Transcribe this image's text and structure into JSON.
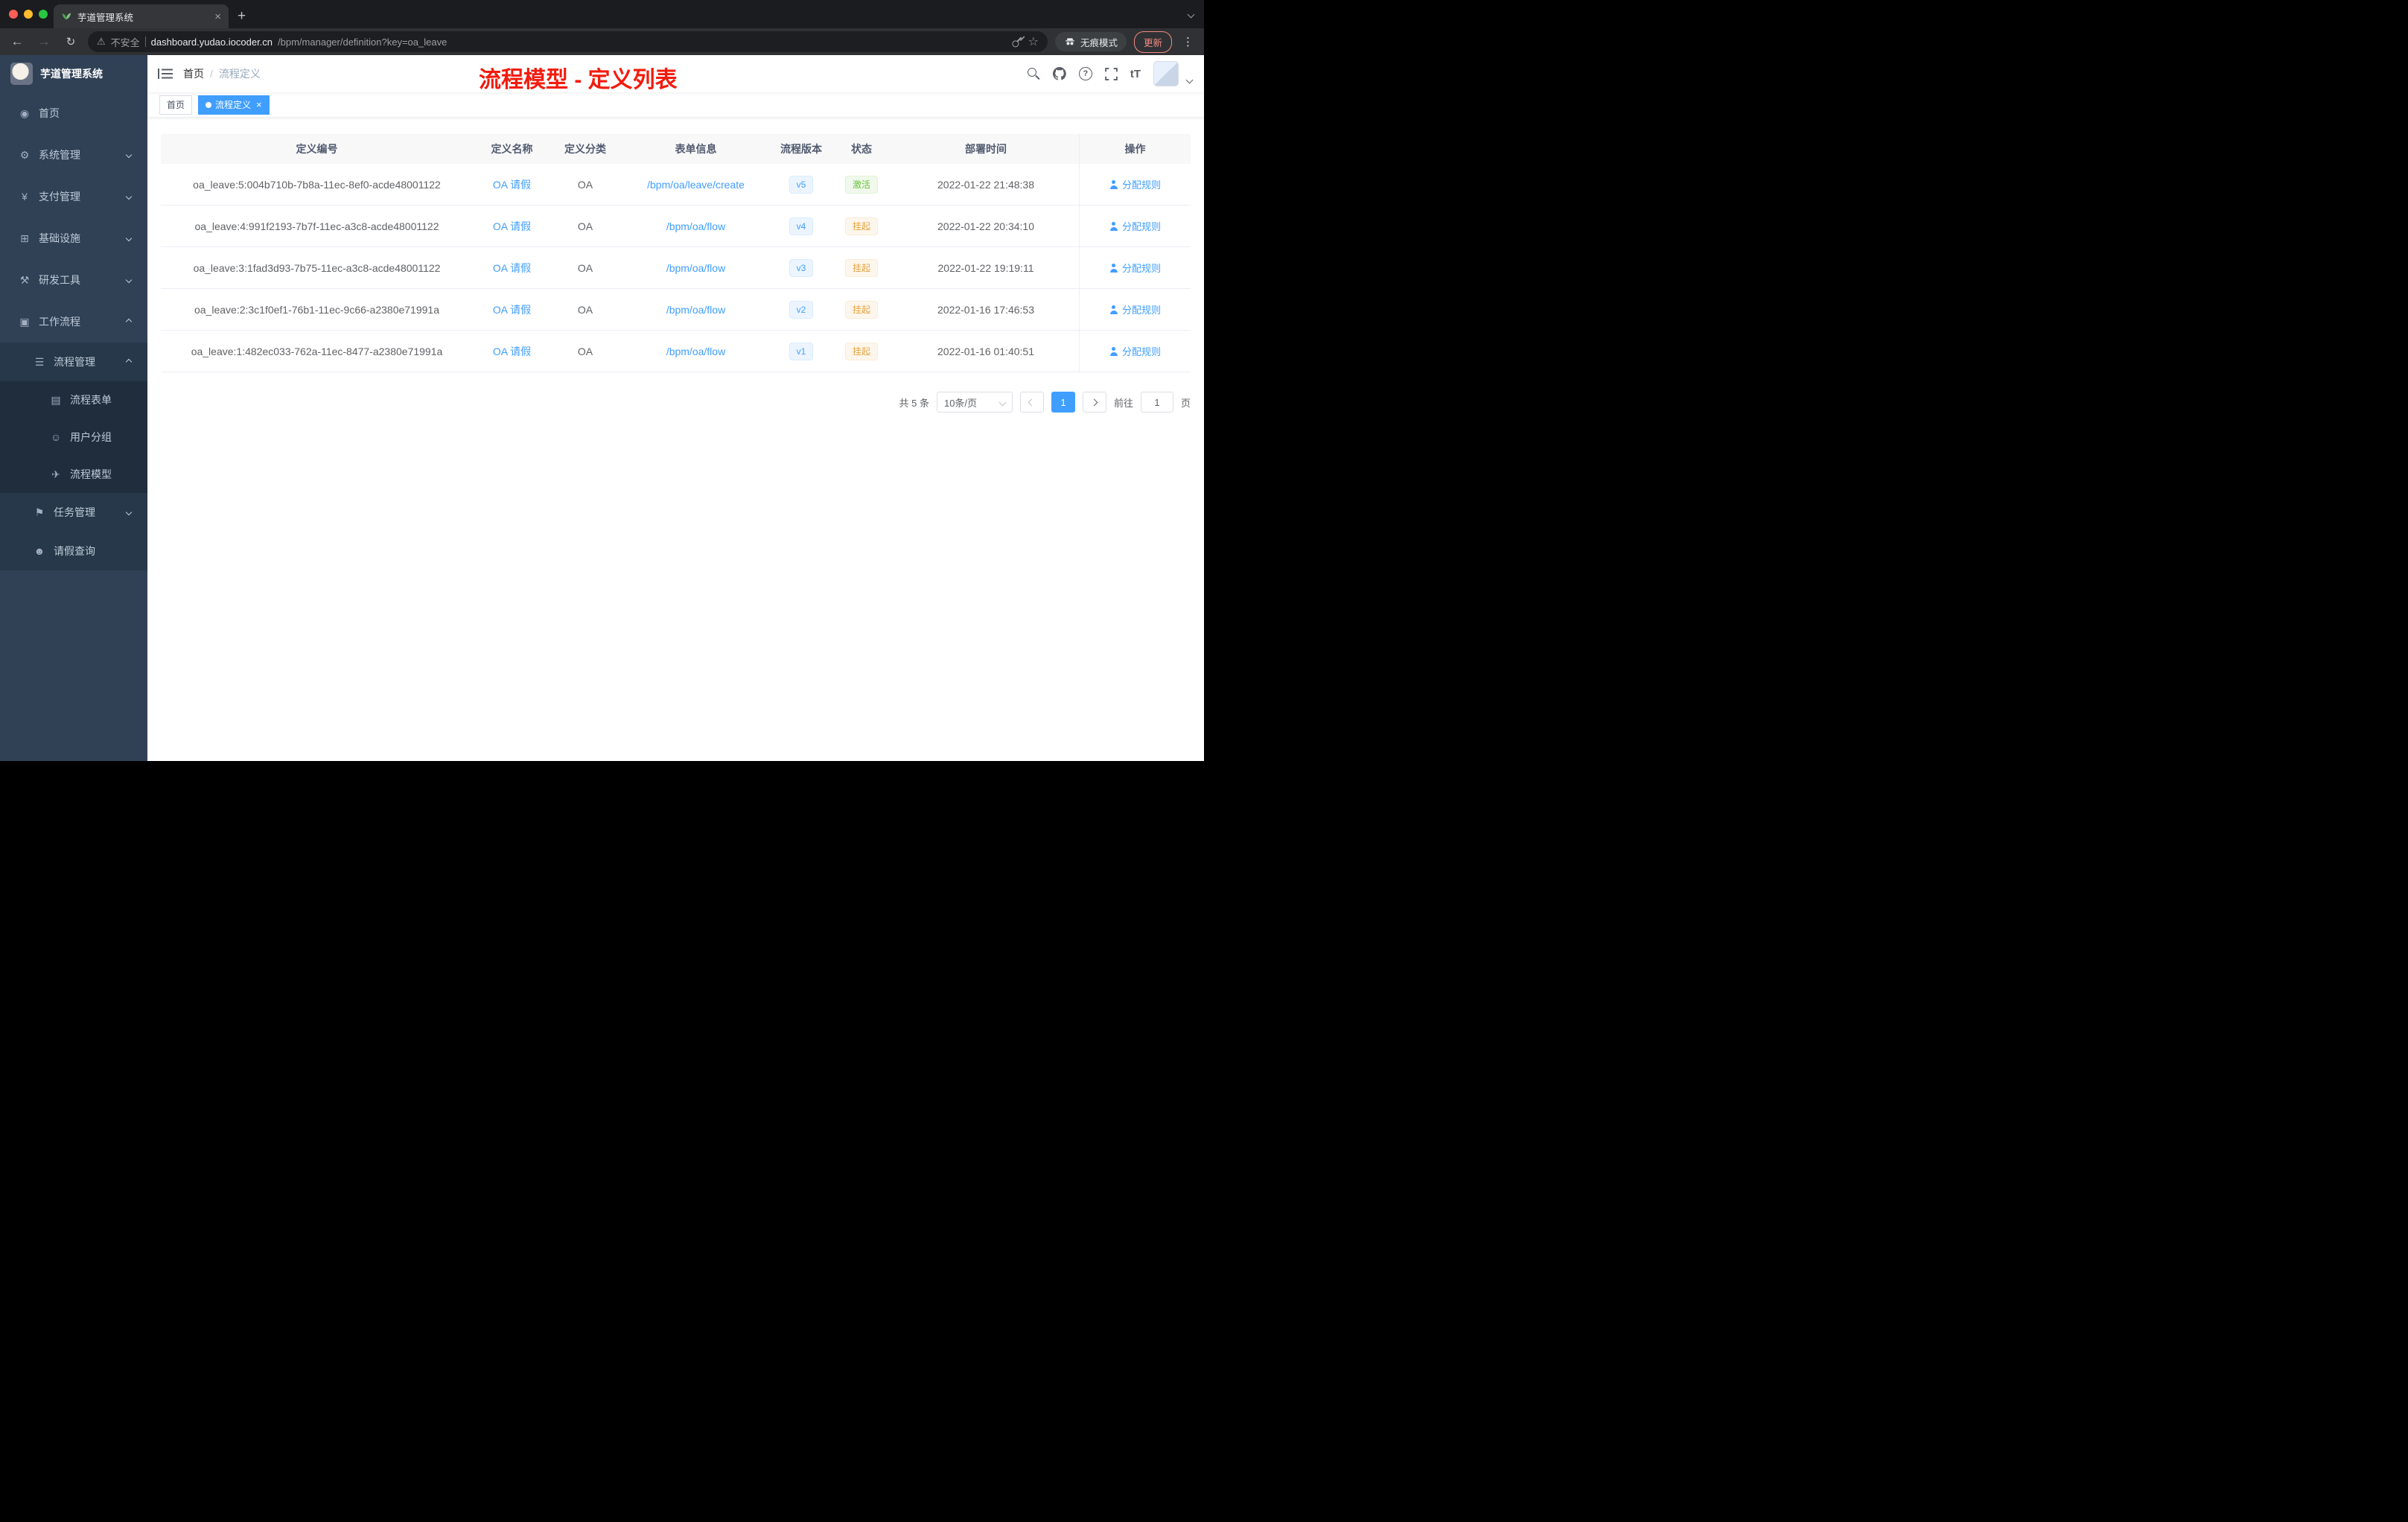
{
  "browser": {
    "tab": {
      "title": "芋道管理系统",
      "close_glyph": "×",
      "new_tab_glyph": "+"
    },
    "toolbar": {
      "security_label": "不安全",
      "url_host": "dashboard.yudao.iocoder.cn",
      "url_path": "/bpm/manager/definition?key=oa_leave",
      "incognito_label": "无痕模式",
      "update_label": "更新",
      "icons": {
        "back": "←",
        "forward": "→",
        "reload": "↻",
        "warning": "⚠",
        "star": "☆",
        "dots": "⋮"
      }
    }
  },
  "sidebar": {
    "logo_title": "芋道管理系统",
    "menu": [
      {
        "key": "home",
        "label": "首页",
        "icon": "dashboard-icon",
        "glyph": "◉",
        "level": 1,
        "expand": null
      },
      {
        "key": "system-management",
        "label": "系统管理",
        "icon": "gear-icon",
        "glyph": "⚙",
        "level": 1,
        "expand": "down"
      },
      {
        "key": "payment-management",
        "label": "支付管理",
        "icon": "yen-icon",
        "glyph": "¥",
        "level": 1,
        "expand": "down"
      },
      {
        "key": "infrastructure",
        "label": "基础设施",
        "icon": "infrastructure-icon",
        "glyph": "⊞",
        "level": 1,
        "expand": "down"
      },
      {
        "key": "dev-tools",
        "label": "研发工具",
        "icon": "tools-icon",
        "glyph": "⚒",
        "level": 1,
        "expand": "down"
      },
      {
        "key": "workflow",
        "label": "工作流程",
        "icon": "workflow-icon",
        "glyph": "▣",
        "level": 1,
        "expand": "up"
      },
      {
        "key": "process-management",
        "label": "流程管理",
        "icon": "process-list-icon",
        "glyph": "☰",
        "level": 2,
        "expand": "up"
      },
      {
        "key": "process-form",
        "label": "流程表单",
        "icon": "form-icon",
        "glyph": "▤",
        "level": 3,
        "expand": null
      },
      {
        "key": "user-group",
        "label": "用户分组",
        "icon": "user-group-icon",
        "glyph": "☺",
        "level": 3,
        "expand": null
      },
      {
        "key": "process-model",
        "label": "流程模型",
        "icon": "paper-plane-icon",
        "glyph": "✈",
        "level": 3,
        "expand": null
      },
      {
        "key": "task-management",
        "label": "任务管理",
        "icon": "flag-icon",
        "glyph": "⚑",
        "level": 2,
        "expand": "down"
      },
      {
        "key": "leave-query",
        "label": "请假查询",
        "icon": "person-icon",
        "glyph": "☻",
        "level": 2,
        "expand": null
      }
    ]
  },
  "header": {
    "breadcrumb": {
      "home": "首页",
      "separator": "/",
      "current": "流程定义"
    },
    "annotation": "流程模型 - 定义列表",
    "icons": {
      "question": "?",
      "font_size": "tT"
    }
  },
  "tags": [
    {
      "label": "首页",
      "active": false,
      "closable": false
    },
    {
      "label": "流程定义",
      "active": true,
      "closable": true
    }
  ],
  "table": {
    "columns": [
      "定义编号",
      "定义名称",
      "定义分类",
      "表单信息",
      "流程版本",
      "状态",
      "部署时间",
      "操作"
    ],
    "rows": [
      {
        "id": "oa_leave:5:004b710b-7b8a-11ec-8ef0-acde48001122",
        "name": "OA 请假",
        "category": "OA",
        "form": "/bpm/oa/leave/create",
        "version": "v5",
        "status": "激活",
        "status_type": "success",
        "deploy_time": "2022-01-22 21:48:38",
        "action": "分配规则"
      },
      {
        "id": "oa_leave:4:991f2193-7b7f-11ec-a3c8-acde48001122",
        "name": "OA 请假",
        "category": "OA",
        "form": "/bpm/oa/flow",
        "version": "v4",
        "status": "挂起",
        "status_type": "warning",
        "deploy_time": "2022-01-22 20:34:10",
        "action": "分配规则"
      },
      {
        "id": "oa_leave:3:1fad3d93-7b75-11ec-a3c8-acde48001122",
        "name": "OA 请假",
        "category": "OA",
        "form": "/bpm/oa/flow",
        "version": "v3",
        "status": "挂起",
        "status_type": "warning",
        "deploy_time": "2022-01-22 19:19:11",
        "action": "分配规则"
      },
      {
        "id": "oa_leave:2:3c1f0ef1-76b1-11ec-9c66-a2380e71991a",
        "name": "OA 请假",
        "category": "OA",
        "form": "/bpm/oa/flow",
        "version": "v2",
        "status": "挂起",
        "status_type": "warning",
        "deploy_time": "2022-01-16 17:46:53",
        "action": "分配规则"
      },
      {
        "id": "oa_leave:1:482ec033-762a-11ec-8477-a2380e71991a",
        "name": "OA 请假",
        "category": "OA",
        "form": "/bpm/oa/flow",
        "version": "v1",
        "status": "挂起",
        "status_type": "warning",
        "deploy_time": "2022-01-16 01:40:51",
        "action": "分配规则"
      }
    ]
  },
  "pagination": {
    "total": "共 5 条",
    "page_size": "10条/页",
    "current_page": "1",
    "goto_label": "前往",
    "goto_value": "1",
    "unit_label": "页"
  },
  "colors": {
    "accent_blue": "#409eff",
    "success_green": "#67c23a",
    "warning_orange": "#e6a23c",
    "annotation_red": "#f21c0d",
    "sidebar_bg": "#304156",
    "submenu_bg": "#1f2d3d"
  }
}
